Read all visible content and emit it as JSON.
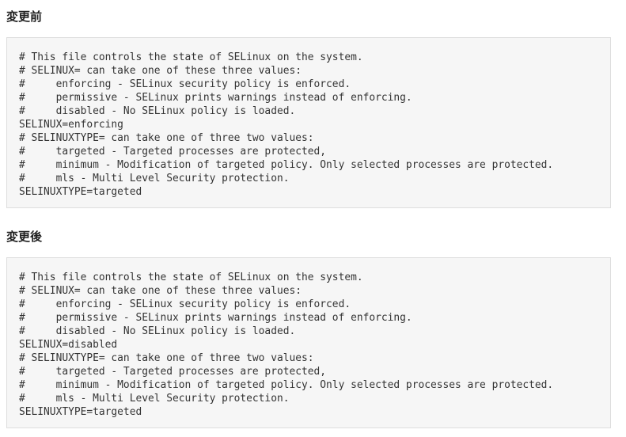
{
  "before": {
    "heading": "変更前",
    "lines": [
      "# This file controls the state of SELinux on the system.",
      "# SELINUX= can take one of these three values:",
      "#     enforcing - SELinux security policy is enforced.",
      "#     permissive - SELinux prints warnings instead of enforcing.",
      "#     disabled - No SELinux policy is loaded.",
      "SELINUX=enforcing",
      "# SELINUXTYPE= can take one of three two values:",
      "#     targeted - Targeted processes are protected,",
      "#     minimum - Modification of targeted policy. Only selected processes are protected.",
      "#     mls - Multi Level Security protection.",
      "SELINUXTYPE=targeted"
    ]
  },
  "after": {
    "heading": "変更後",
    "lines": [
      "# This file controls the state of SELinux on the system.",
      "# SELINUX= can take one of these three values:",
      "#     enforcing - SELinux security policy is enforced.",
      "#     permissive - SELinux prints warnings instead of enforcing.",
      "#     disabled - No SELinux policy is loaded.",
      "SELINUX=disabled",
      "# SELINUXTYPE= can take one of three two values:",
      "#     targeted - Targeted processes are protected,",
      "#     minimum - Modification of targeted policy. Only selected processes are protected.",
      "#     mls - Multi Level Security protection.",
      "SELINUXTYPE=targeted"
    ]
  }
}
